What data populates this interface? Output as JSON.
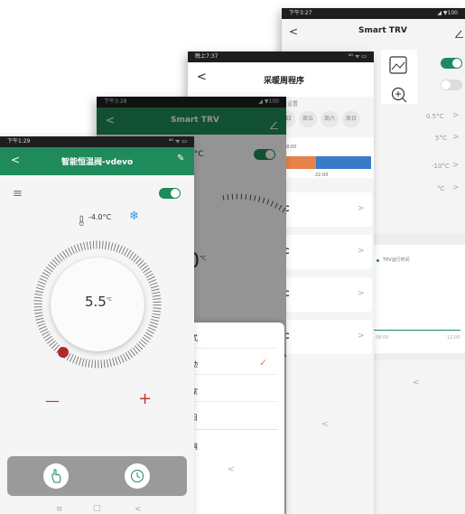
{
  "colors": {
    "accent": "#1f8a5b",
    "orange": "#e8824a",
    "blue": "#3a7bc8",
    "red": "#c0392b",
    "navy": "#2c6db5"
  },
  "phone4": {
    "status_time": "下午3:27",
    "status_right": "◢ ▼100",
    "back": "<",
    "title": "Smart TRV",
    "edit_icon": "pencil-icon",
    "icons": [
      "image-edit-icon",
      "zoom-in-icon",
      "more-icon"
    ],
    "more_label": "···",
    "rows": [
      {
        "value": "0.5°C"
      },
      {
        "value": "5°C"
      },
      {
        "value": "-10°C"
      },
      {
        "value": "°C"
      }
    ],
    "legend": "TRV运行时间",
    "ticks": [
      "08:00",
      "12:00"
    ],
    "nav_back": "<"
  },
  "phone3": {
    "status_time": "晚上7:37",
    "status_right": "⁴ᴳ ᯤ ▭",
    "back": "<",
    "title": "采暖周程序",
    "subtitle": "设置",
    "days": [
      "四",
      "周五",
      "周六",
      "周日"
    ],
    "time_a": "18:00",
    "time_b": "22:00",
    "periods": [
      {
        "temp": "C"
      },
      {
        "temp": "C"
      },
      {
        "temp": "C"
      },
      {
        "temp": "C"
      }
    ],
    "chevron": ">",
    "nav_back": "<"
  },
  "sheet": {
    "items": [
      {
        "label": "式"
      },
      {
        "label": "动"
      },
      {
        "label": "家"
      },
      {
        "label": "日"
      }
    ],
    "check": "✓",
    "cancel": "消",
    "nav_back": "<"
  },
  "phone2": {
    "status_time": "下午3:28",
    "status_right": "◢ ▼100",
    "back": "<",
    "title": "Smart TRV",
    "temp": "0°C",
    "dial_value": "0",
    "dial_unit": "°C"
  },
  "phone1": {
    "status_time": "下午1:29",
    "status_right": "⁴ᴳ ᯤ ▭",
    "back": "<",
    "title": "智能恒温阀-vdevo",
    "edit": "✎",
    "menu": "≡",
    "current_temp": "-4.0°C",
    "setpoint": "5.5",
    "setpoint_unit": "°C",
    "minus": "—",
    "plus": "+",
    "nav": [
      "≡",
      "□",
      "<"
    ]
  }
}
